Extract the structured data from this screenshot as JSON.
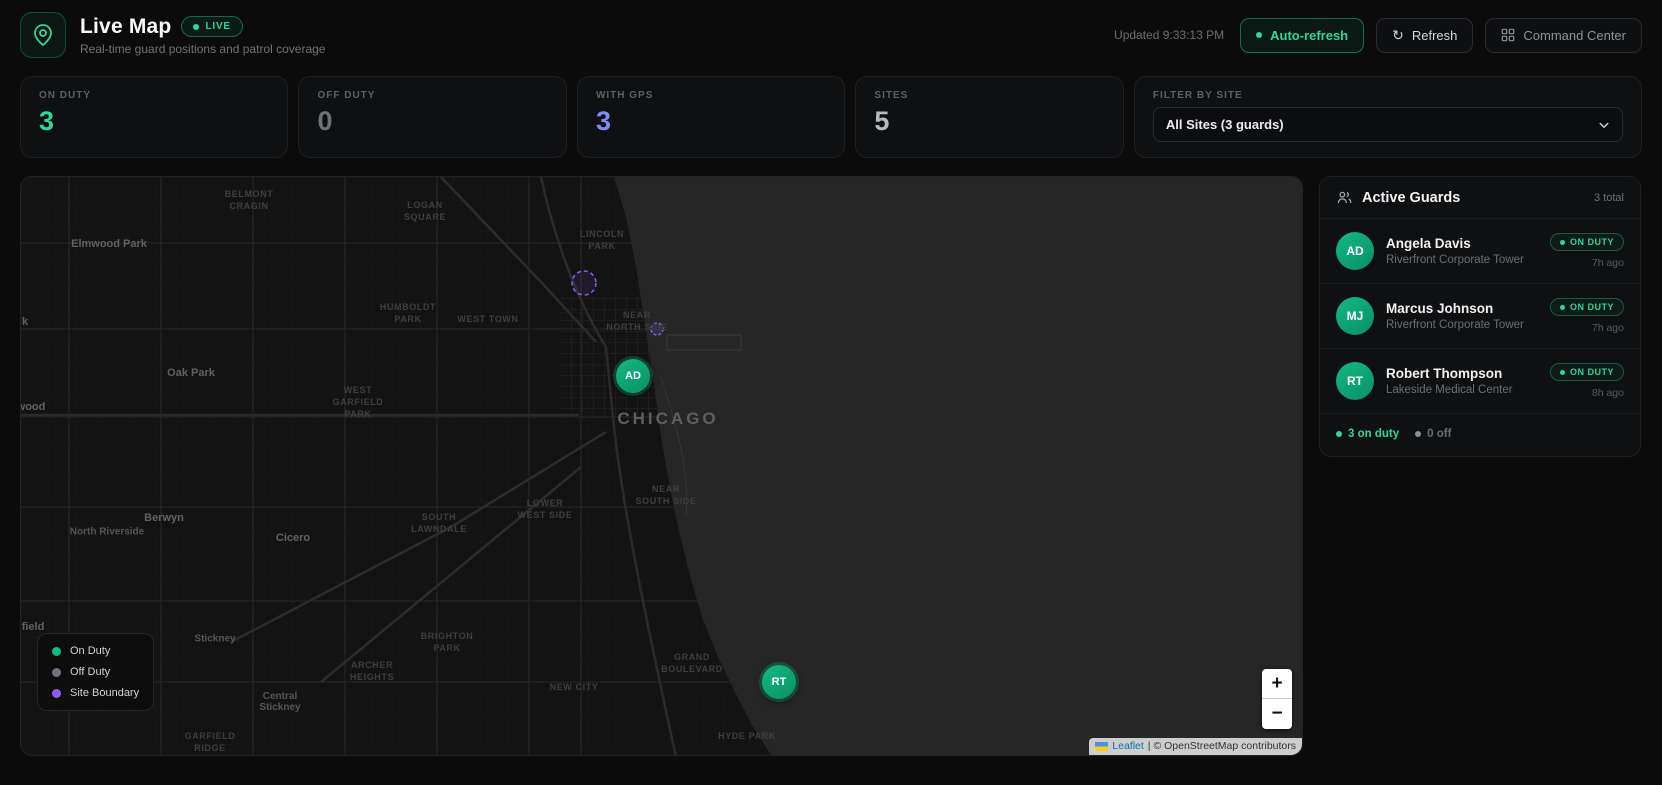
{
  "header": {
    "title": "Live Map",
    "live_badge": "LIVE",
    "subtitle": "Real-time guard positions and patrol coverage",
    "updated": "Updated 9:33:13 PM",
    "auto_refresh_label": "Auto-refresh",
    "refresh_label": "Refresh",
    "refresh_icon": "↻",
    "command_center_label": "Command Center"
  },
  "stats": [
    {
      "label": "ON DUTY",
      "value": "3"
    },
    {
      "label": "OFF DUTY",
      "value": "0"
    },
    {
      "label": "WITH GPS",
      "value": "3"
    },
    {
      "label": "SITES",
      "value": "5"
    }
  ],
  "filter": {
    "label": "FILTER BY SITE",
    "selected": "All Sites (3 guards)"
  },
  "map": {
    "labels": [
      {
        "text": "BELMONT\nCRAGIN"
      },
      {
        "text": "LOGAN\nSQUARE"
      },
      {
        "text": "LINCOLN\nPARK"
      },
      {
        "text": "Elmwood Park"
      },
      {
        "text": "HUMBOLDT\nPARK"
      },
      {
        "text": "WEST TOWN"
      },
      {
        "text": "NEAR\nNORTH SIDE"
      },
      {
        "text": "Oak Park"
      },
      {
        "text": "WEST\nGARFIELD\nPARK"
      },
      {
        "text": "CHICAGO"
      },
      {
        "text": "NEAR\nSOUTH SIDE"
      },
      {
        "text": "LOWER\nWEST SIDE"
      },
      {
        "text": "SOUTH\nLAWNDALE"
      },
      {
        "text": "Berwyn"
      },
      {
        "text": "Cicero"
      },
      {
        "text": "North Riverside"
      },
      {
        "text": "Stickney"
      },
      {
        "text": "BRIGHTON\nPARK"
      },
      {
        "text": "ARCHER\nHEIGHTS"
      },
      {
        "text": "GRAND\nBOULEVARD"
      },
      {
        "text": "NEW CITY"
      },
      {
        "text": "HYDE PARK"
      },
      {
        "text": "Central\nStickney"
      },
      {
        "text": "GARFIELD\nRIDGE"
      },
      {
        "text": "field"
      },
      {
        "text": "wood"
      },
      {
        "text": "k"
      }
    ],
    "markers": [
      {
        "initials": "AD"
      },
      {
        "initials": "RT"
      }
    ],
    "legend": [
      {
        "label": "On Duty"
      },
      {
        "label": "Off Duty"
      },
      {
        "label": "Site Boundary"
      }
    ],
    "zoom_in": "+",
    "zoom_out": "−",
    "attribution": {
      "leaflet": "Leaflet",
      "rest": "| © OpenStreetMap contributors"
    }
  },
  "sidebar": {
    "title": "Active Guards",
    "total": "3 total",
    "guards": [
      {
        "initials": "AD",
        "name": "Angela Davis",
        "site": "Riverfront Corporate Tower",
        "status": "ON DUTY",
        "last_seen": "7h ago"
      },
      {
        "initials": "MJ",
        "name": "Marcus Johnson",
        "site": "Riverfront Corporate Tower",
        "status": "ON DUTY",
        "last_seen": "7h ago"
      },
      {
        "initials": "RT",
        "name": "Robert Thompson",
        "site": "Lakeside Medical Center",
        "status": "ON DUTY",
        "last_seen": "8h ago"
      }
    ],
    "footer": {
      "on_duty": "3 on duty",
      "off_duty": "0 off"
    }
  },
  "colors": {
    "accent_green": "#34d399",
    "marker_green": "#10b981",
    "gps_purple": "#818cf8",
    "site_boundary_purple": "#8b5cf6",
    "off_duty_gray": "#6b7280",
    "lake_gray": "#262626",
    "land_dark": "#131313",
    "panel_bg": "#0f1011",
    "page_bg": "#0b0b0c"
  }
}
